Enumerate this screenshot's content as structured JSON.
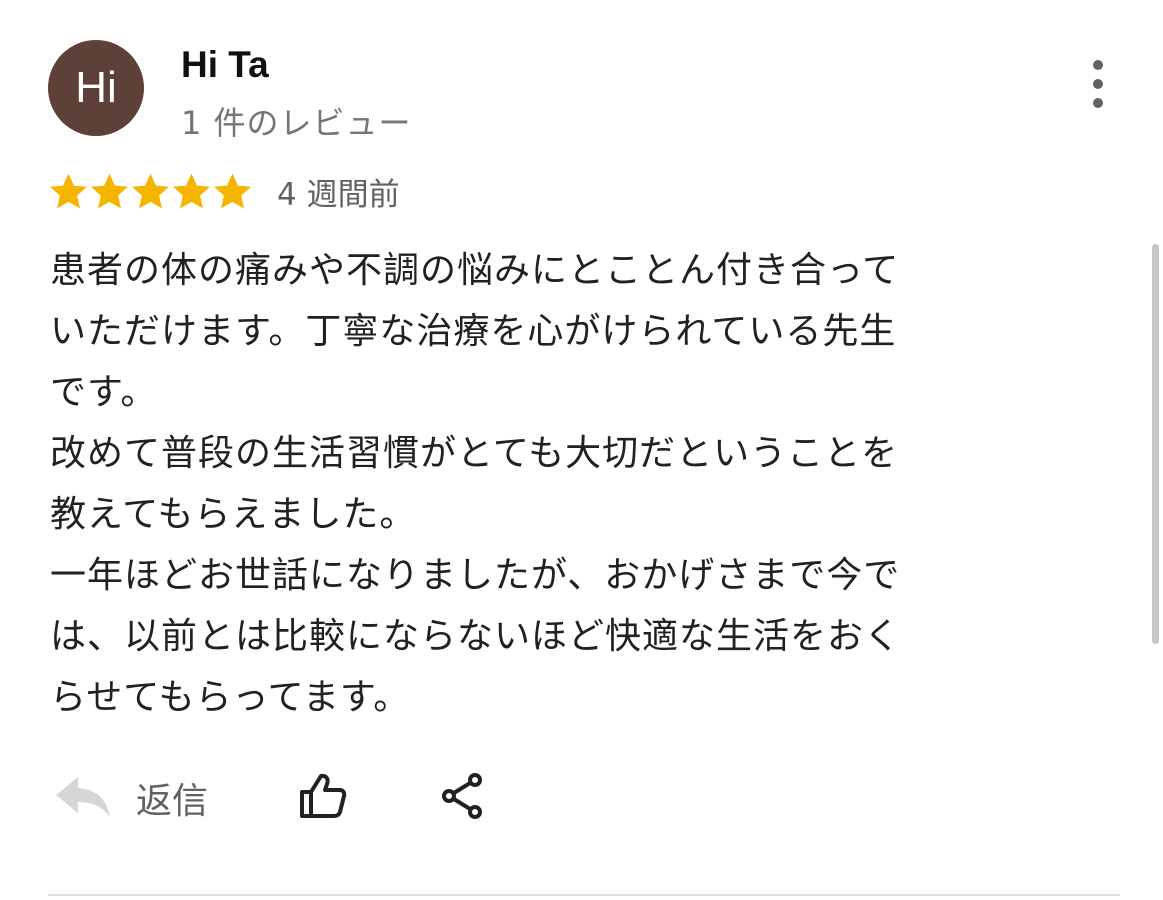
{
  "reviewer": {
    "avatar_initials": "Hi",
    "avatar_color": "#5d4037",
    "name": "Hi Ta",
    "review_count": "1 件のレビュー"
  },
  "review": {
    "rating": 5,
    "max_rating": 5,
    "star_color": "#f4b400",
    "time_ago": "4 週間前",
    "text_lines": [
      "患者の体の痛みや不調の悩みにとことん付き合って",
      "いただけます。丁寧な治療を心がけられている先生",
      "です。",
      "改めて普段の生活習慣がとても大切だということを",
      "教えてもらえました。",
      "一年ほどお世話になりましたが、おかげさまで今で",
      "は、以前とは比較にならないほど快適な生活をおく",
      "らせてもらってます。"
    ]
  },
  "actions": {
    "reply_label": "返信",
    "reply_icon": "reply-arrow-icon",
    "like_icon": "thumbs-up-icon",
    "share_icon": "share-icon",
    "more_icon": "more-vert-icon"
  }
}
